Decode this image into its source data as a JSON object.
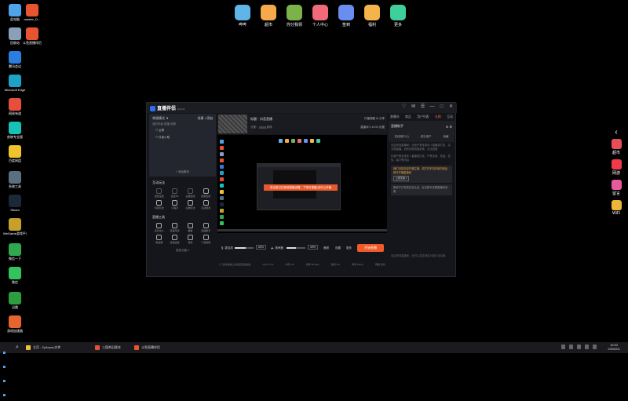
{
  "desktop_icons": [
    {
      "label": "此电脑",
      "color": "#4fa3e8"
    },
    {
      "label": "master_D...",
      "color": "#e8542f"
    },
    {
      "label": "回收站",
      "color": "#8aa0b8"
    },
    {
      "label": "斗鱼直播伴侣",
      "color": "#e8542f"
    },
    {
      "label": "腾讯会议",
      "color": "#2b7de0"
    },
    {
      "label": "Microsoft Edge",
      "color": "#1da1c8"
    },
    {
      "label": "网易有道",
      "color": "#e84e3c"
    },
    {
      "label": "剪映专业版",
      "color": "#16c1b8"
    },
    {
      "label": "百度网盘",
      "color": "#f0c22b"
    },
    {
      "label": "系统工具",
      "color": "#5a6f80"
    },
    {
      "label": "Steam",
      "color": "#1b2838"
    },
    {
      "label": "WeGame游戏平台",
      "color": "#c7a02a"
    },
    {
      "label": "微信一下",
      "color": "#2fa84f"
    },
    {
      "label": "微信",
      "color": "#33c35c"
    },
    {
      "label": "迅雷",
      "color": "#2b9e3f"
    },
    {
      "label": "游戏加速器",
      "color": "#e8642f"
    }
  ],
  "top_dock": [
    {
      "label": "哔哔",
      "color": "#5fb4e8"
    },
    {
      "label": "超市",
      "color": "#f5a94a"
    },
    {
      "label": "你分我领",
      "color": "#7bb34a"
    },
    {
      "label": "个人中心",
      "color": "#f06a7a"
    },
    {
      "label": "签到",
      "color": "#6a8ef0"
    },
    {
      "label": "福利",
      "color": "#f5b44a"
    },
    {
      "label": "更多",
      "color": "#3fcf9a"
    }
  ],
  "right_bar": {
    "chevron": "‹",
    "items": [
      {
        "label": "超市",
        "color": "#e84e5a"
      },
      {
        "label": "网游",
        "color": "#f03a4a"
      },
      {
        "label": "留言",
        "color": "#e85a9a"
      },
      {
        "label": "WiFi",
        "color": "#f0b43a"
      }
    ]
  },
  "app": {
    "title": "直播伴侣",
    "version": "4.1.1.0",
    "window_controls": [
      "♡",
      "✉",
      "☰",
      "—",
      "□",
      "✕"
    ],
    "scene": {
      "mode": "常规模式 ▼",
      "scene_label": "场景",
      "more": "+添加",
      "sub": "我的场景   直播   视频",
      "rows": [
        "☐  全屏",
        "☐  抖音小助"
      ],
      "add_source": "+  添加素材"
    },
    "interact": {
      "title": "互动玩法",
      "items": [
        "连线设置",
        "连麦PK",
        "主播连线",
        "视频连线",
        "抖音玩法",
        "小程序",
        "礼物玩法",
        "互动游戏"
      ]
    },
    "tools": {
      "title": "直播工具",
      "items": [
        "任务中心",
        "直播带货",
        "福袋",
        "直播助手",
        "粉丝群",
        "直播设置",
        "音效",
        "下载视频"
      ],
      "more": "更多功能 ▾"
    },
    "stream": {
      "title": "标题：抖音直播",
      "category": "分类：",
      "category_value": "游戏",
      "head_right_1": "开播提醒  ⚙ 分享",
      "head_right_2": "直播间 ▾  10:00  设置"
    },
    "preview": {
      "alert": "您当前已在其他直播设置，下场可直播,还可以开播"
    },
    "controls": {
      "mic_label": "麦克风",
      "mic_pct": "60%",
      "speaker_label": "扬声器",
      "speaker_pct": "49%",
      "mic_level": 0.6,
      "speaker_level": 0.49,
      "btn_beauty": "美颜",
      "btn_settings": "设置",
      "btn_more": "更多",
      "start_button": "开始直播"
    },
    "status_bar": {
      "left": "◯ 您的电脑上未连接直播设备",
      "items": [
        "CPU 0.7%",
        "内存 1%",
        "帧率 60.0fps",
        "丢帧 0%",
        "码率 0kbps",
        "网络 良好"
      ]
    },
    "right_panel": {
      "tabs": [
        "直播间",
        "商品",
        "用户列表",
        "礼物",
        "互动"
      ],
      "active_tab": 3,
      "sub_title": "直播助手",
      "sub_icons": [
        "⊟",
        "⚙"
      ],
      "sub_tabs": [
        "在线用户(1)",
        "送礼用户",
        "贡献"
      ],
      "msgs": [
        "欢迎来到直播间！抖音严禁未成年人直播或打赏，请文明直播，如有违规将被封禁，点击查看",
        "抖音严禁未成年人直播或打赏，严禁涉政、低俗、色情、暴力等内容"
      ],
      "bubble_1": "我们当前欢迎开通主播，请打开手机抖音扫码后即可开播直播间",
      "bubble_1_btn": "立即查看 ▾",
      "bubble_2": "新用户已完成实名认证，点击即可查看直播间设置",
      "input_hint": "欢迎来到直播间，还可以发送消息与观众互动哦"
    }
  },
  "taskbar": {
    "items": [
      {
        "label": "主页 - ZyAnyou文件",
        "color": "#f0c23a"
      },
      {
        "label": "三国杀旧版本",
        "color": "#e84e3c"
      },
      {
        "label": "斗鱼直播伴侣",
        "color": "#e8542f"
      }
    ],
    "time": "15:02",
    "date": "2025/2/1"
  }
}
